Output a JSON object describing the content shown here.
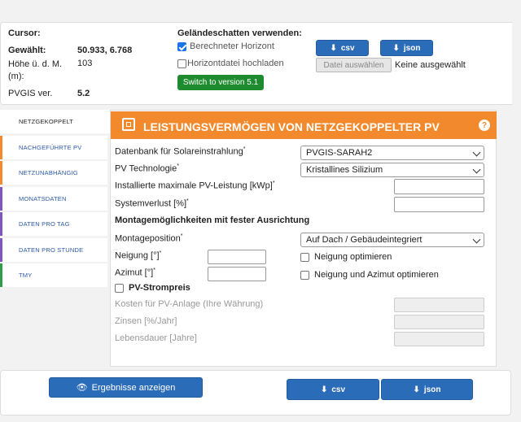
{
  "info": {
    "cursor_label": "Cursor:",
    "selected_label": "Gewählt:",
    "selected_value": "50.933, 6.768",
    "height_label": "Höhe ü. d. M. (m):",
    "height_value": "103",
    "version_label": "PVGIS ver.",
    "version_value": "5.2"
  },
  "terrain": {
    "title": "Geländeschatten verwenden:",
    "calc_horizon_label": "Berechneter Horizont",
    "calc_horizon_checked": true,
    "upload_horizon_label": "Horizontdatei hochladen",
    "upload_horizon_checked": false,
    "switch_version_label": "Switch to version 5.1",
    "csv_label": "csv",
    "json_label": "json",
    "choose_file_label": "Datei auswählen",
    "no_file_label": "Keine ausgewählt"
  },
  "tabs": [
    {
      "label": "NETZGEKOPPELT",
      "color": "#ffffff",
      "active": true
    },
    {
      "label": "NACHGEFÜHRTE PV",
      "color": "#f28a2d",
      "active": false
    },
    {
      "label": "NETZUNABHÄNGIG",
      "color": "#f28a2d",
      "active": false
    },
    {
      "label": "MONATSDATEN",
      "color": "#7e57c2",
      "active": false
    },
    {
      "label": "DATEN PRO TAG",
      "color": "#7e57c2",
      "active": false
    },
    {
      "label": "DATEN PRO STUNDE",
      "color": "#7e57c2",
      "active": false
    },
    {
      "label": "TMY",
      "color": "#2e9d48",
      "active": false
    }
  ],
  "form": {
    "title": "LEISTUNGSVERMÖGEN VON NETZGEKOPPELTER PV",
    "help": "?",
    "database_label": "Datenbank für Solareinstrahlung",
    "database_value": "PVGIS-SARAH2",
    "technology_label": "PV Technologie",
    "technology_value": "Kristallines Silizium",
    "peak_power_label": "Installierte maximale PV-Leistung [kWp]",
    "peak_power_value": "",
    "system_loss_label": "Systemverlust [%]",
    "system_loss_value": "",
    "mounting_section_title": "Montagemöglichkeiten mit fester Ausrichtung",
    "mounting_position_label": "Montageposition",
    "mounting_position_value": "Auf Dach / Gebäudeintegriert",
    "slope_label": "Neigung [°]",
    "slope_value": "",
    "azimuth_label": "Azimut [°]",
    "azimuth_value": "",
    "optimize_slope_label": "Neigung optimieren",
    "optimize_both_label": "Neigung und Azimut optimieren",
    "pv_price_label": "PV-Strompreis",
    "cost_label": "Kosten für PV-Anlage (Ihre Währung)",
    "interest_label": "Zinsen [%/Jahr]",
    "lifetime_label": "Lebensdauer [Jahre]",
    "required_mark": "*"
  },
  "actions": {
    "show_results_label": "Ergebnisse anzeigen",
    "csv_label": "csv",
    "json_label": "json"
  },
  "colors": {
    "header": "#f28a2d",
    "primary_button": "#2b6cb8",
    "version_button": "#1e8b2f",
    "valid_check": "#2e7d32"
  }
}
